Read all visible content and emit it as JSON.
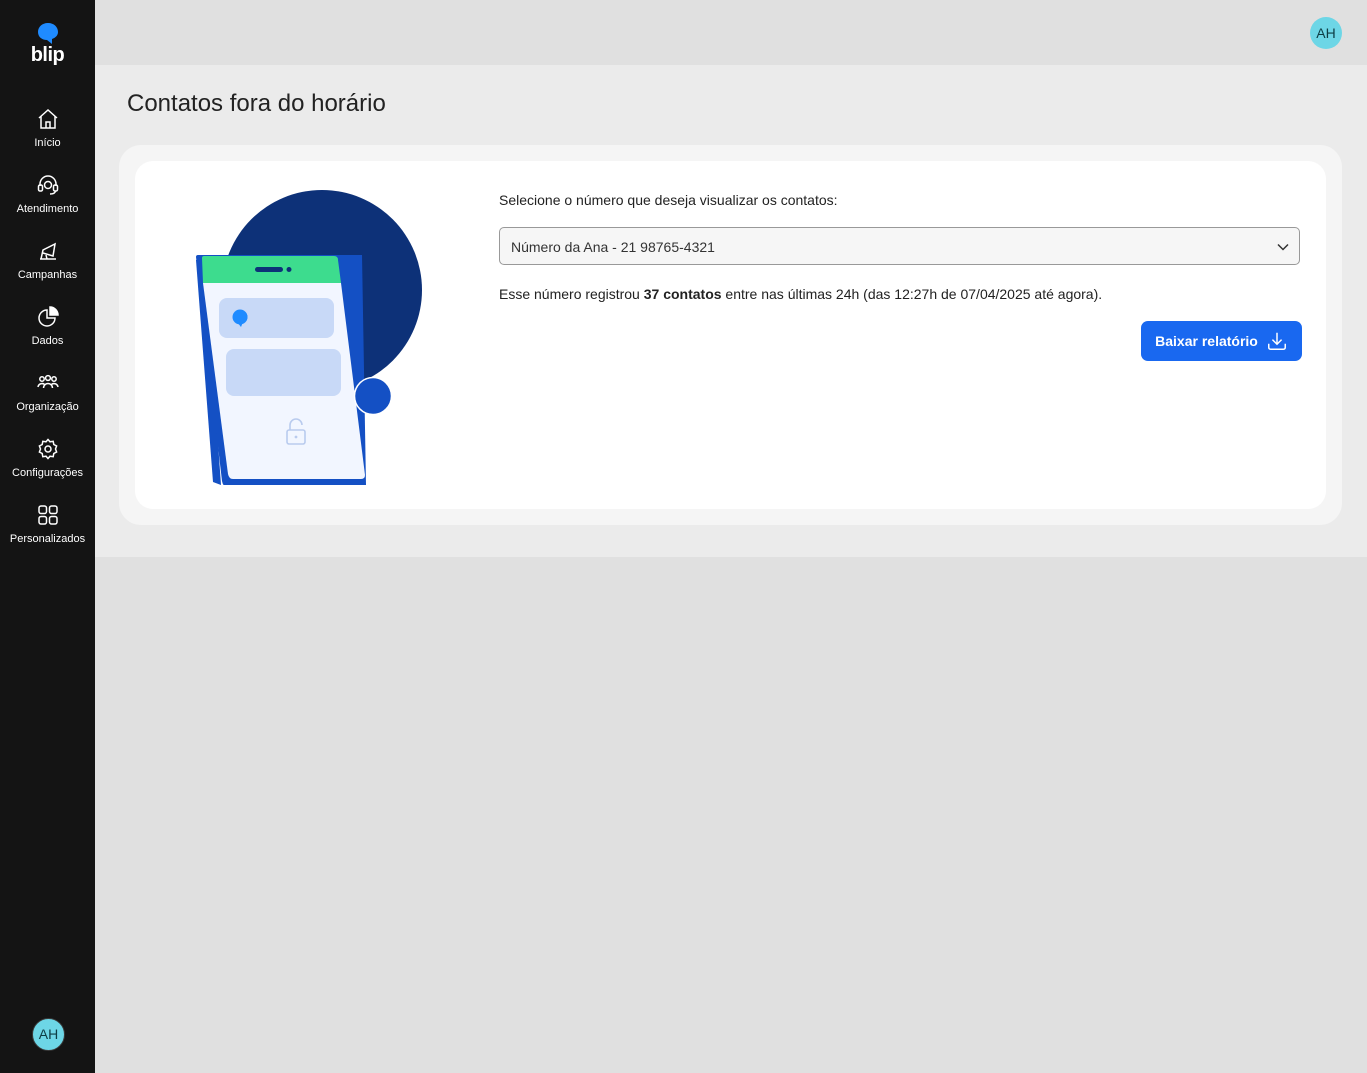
{
  "app": {
    "logo_text": "blip",
    "user_initials": "AH"
  },
  "sidebar": {
    "items": [
      {
        "label": "Início",
        "icon": "home-icon"
      },
      {
        "label": "Atendimento",
        "icon": "headset-icon"
      },
      {
        "label": "Campanhas",
        "icon": "megaphone-icon"
      },
      {
        "label": "Dados",
        "icon": "pie-chart-icon"
      },
      {
        "label": "Organização",
        "icon": "people-group-icon"
      },
      {
        "label": "Configurações",
        "icon": "gear-icon"
      },
      {
        "label": "Personalizados",
        "icon": "grid-icon"
      }
    ]
  },
  "page": {
    "title": "Contatos fora do horário"
  },
  "form": {
    "select_label": "Selecione o número que deseja visualizar os contatos:",
    "selected_number": "Número da Ana - 21 98765-4321",
    "info_prefix": "Esse número registrou ",
    "info_count": "37 contatos",
    "info_suffix": " entre nas últimas 24h (das 12:27h de 07/04/2025 até agora).",
    "download_label": "Baixar relatório"
  },
  "colors": {
    "sidebar_bg": "#141414",
    "accent": "#1968f0",
    "avatar_bg": "#6dd6e6",
    "illustration_navy": "#0d3178",
    "illustration_green": "#3ddc8e"
  }
}
